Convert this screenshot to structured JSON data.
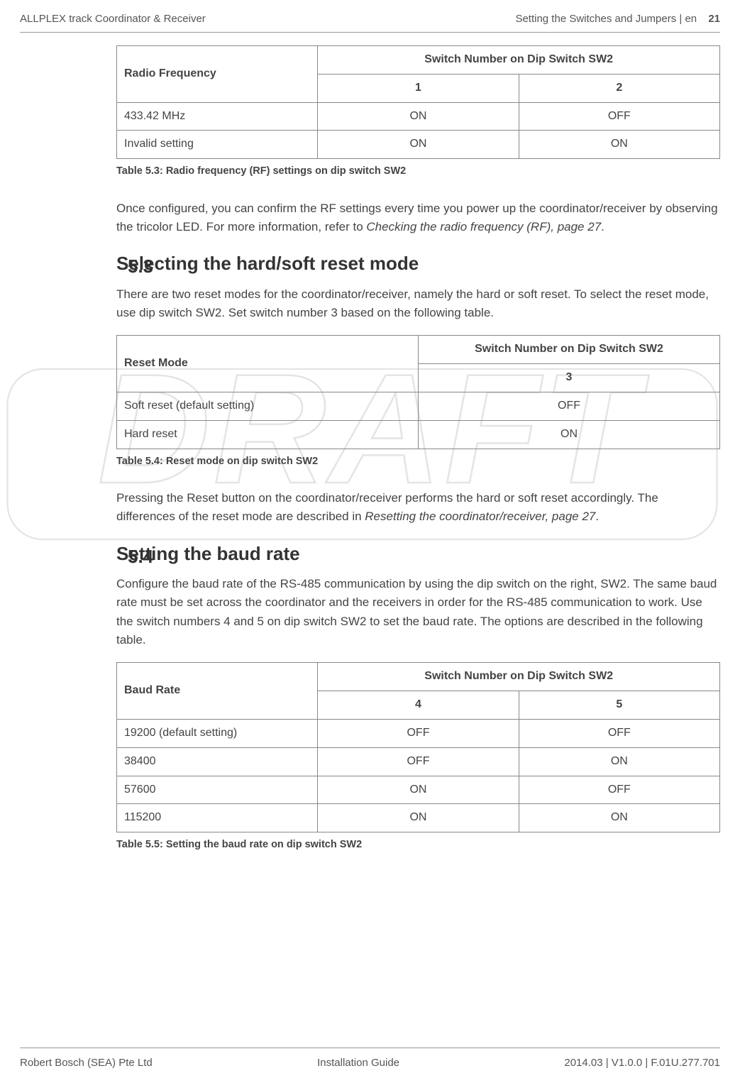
{
  "header": {
    "left": "ALLPLEX track Coordinator & Receiver",
    "right_label": "Setting the Switches and Jumpers | en",
    "page_number": "21"
  },
  "watermark": "DRAFT",
  "table53": {
    "head_left": "Radio Frequency",
    "head_right": "Switch Number on Dip Switch SW2",
    "sub1": "1",
    "sub2": "2",
    "rows": [
      {
        "freq": "433.42 MHz",
        "s1": "ON",
        "s2": "OFF"
      },
      {
        "freq": "Invalid setting",
        "s1": "ON",
        "s2": "ON"
      }
    ],
    "caption": "Table 5.3: Radio frequency (RF) settings on dip switch SW2"
  },
  "para_rf": {
    "t1": "Once configured, you can confirm the RF settings every time you power up the coordinator/receiver by observing the tricolor LED. For more information, refer to ",
    "t2": "Checking the radio frequency (RF), page 27",
    "t3": "."
  },
  "sec53": {
    "num": "5.3",
    "title": "Selecting the hard/soft reset mode",
    "intro": "There are two reset modes for the coordinator/receiver, namely the hard or soft reset. To select the reset mode, use dip switch SW2. Set switch number 3 based on the following table."
  },
  "table54": {
    "head_left": "Reset Mode",
    "head_right": "Switch Number on Dip Switch SW2",
    "sub1": "3",
    "rows": [
      {
        "mode": "Soft reset (default setting)",
        "s3": "OFF"
      },
      {
        "mode": "Hard reset",
        "s3": "ON"
      }
    ],
    "caption": "Table 5.4: Reset mode on dip switch SW2"
  },
  "para_reset": {
    "t1": "Pressing the Reset button on the coordinator/receiver performs the hard or soft reset accordingly. The differences of the reset mode are described in ",
    "t2": "Resetting the coordinator/receiver, page 27",
    "t3": "."
  },
  "sec54": {
    "num": "5.4",
    "title": "Setting the baud rate",
    "intro": "Configure the baud rate of the RS-485 communication by using the dip switch on the right, SW2. The same baud rate must be set across the coordinator and the receivers in order for the RS-485 communication to work. Use the switch numbers 4 and 5 on dip switch SW2 to set the baud rate. The options are described in the following table."
  },
  "table55": {
    "head_left": "Baud Rate",
    "head_right": "Switch Number on Dip Switch SW2",
    "sub1": "4",
    "sub2": "5",
    "rows": [
      {
        "rate": "19200 (default setting)",
        "s4": "OFF",
        "s5": "OFF"
      },
      {
        "rate": "38400",
        "s4": "OFF",
        "s5": "ON"
      },
      {
        "rate": "57600",
        "s4": "ON",
        "s5": "OFF"
      },
      {
        "rate": "115200",
        "s4": "ON",
        "s5": "ON"
      }
    ],
    "caption": "Table 5.5: Setting the baud rate on dip switch SW2"
  },
  "footer": {
    "left": "Robert Bosch (SEA) Pte Ltd",
    "center": "Installation Guide",
    "right": "2014.03 | V1.0.0 | F.01U.277.701"
  }
}
